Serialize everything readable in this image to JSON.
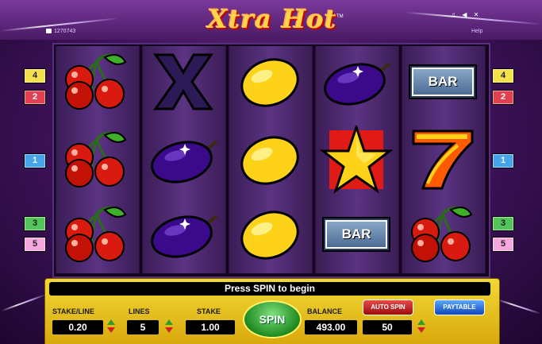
{
  "game": {
    "logo_text": "Xtra Hot",
    "trademark": "TM",
    "session_id": "1270743",
    "help_label": "Help",
    "tools_glyphs": "♫ ◀ ✕"
  },
  "reels": [
    [
      "cherries",
      "cherries",
      "cherries"
    ],
    [
      "x",
      "plum",
      "plum"
    ],
    [
      "lemon",
      "lemon",
      "lemon"
    ],
    [
      "plum",
      "star",
      "bar"
    ],
    [
      "bar",
      "seven",
      "cherries"
    ]
  ],
  "bar_label": "BAR",
  "lines_left": [
    "4",
    "2",
    "1",
    "3",
    "5"
  ],
  "lines_right": [
    "4",
    "2",
    "1",
    "3",
    "5"
  ],
  "panel": {
    "message": "Press SPIN to begin",
    "stake_line_label": "STAKE/LINE",
    "stake_line_value": "0.20",
    "lines_label": "LINES",
    "lines_value": "5",
    "stake_label": "STAKE",
    "stake_value": "1.00",
    "spin_label": "SPIN",
    "balance_label": "BALANCE",
    "balance_value": "493.00",
    "auto_spin_label": "AUTO SPIN",
    "auto_spin_value": "50",
    "paytable_label": "PAYTABLE"
  },
  "colors": {
    "background": "#3d1258",
    "panel": "#e8c020",
    "spin_button": "#1f8a1f",
    "auto_spin_button": "#c01c1c",
    "paytable_button": "#1f5fd0"
  }
}
